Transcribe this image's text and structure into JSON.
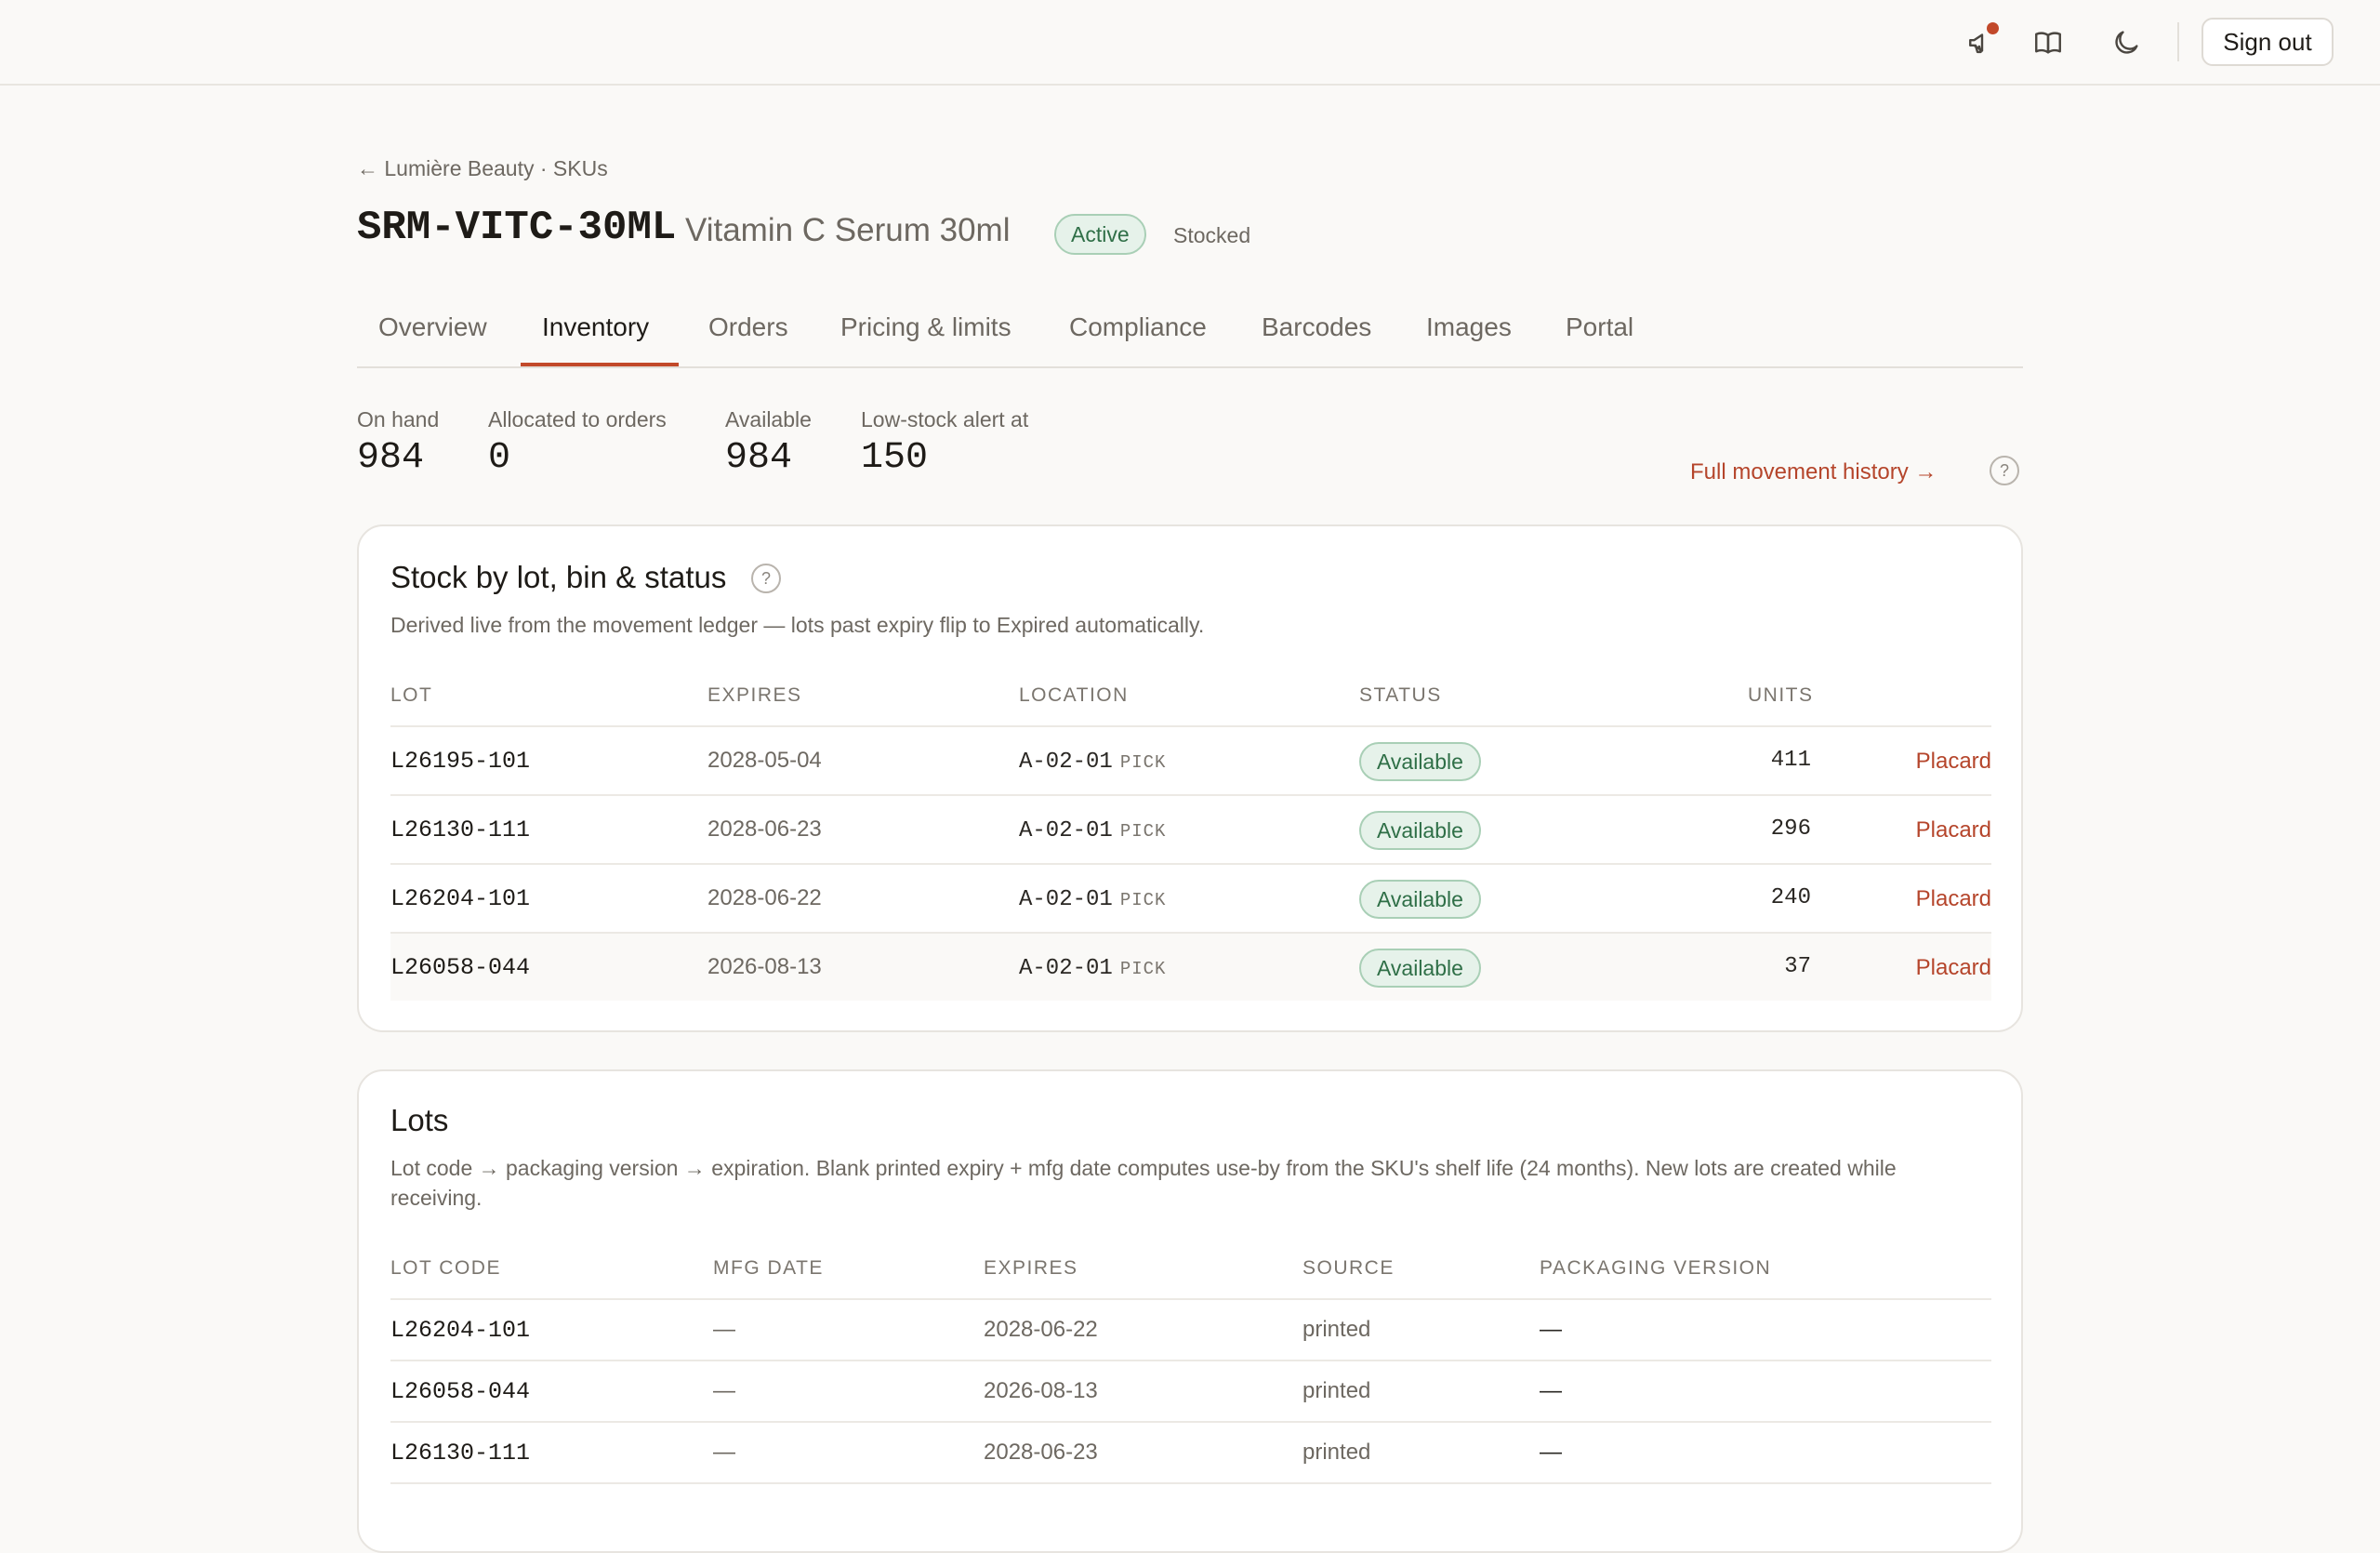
{
  "topbar": {
    "icons": [
      "megaphone-icon",
      "book-icon",
      "moon-icon"
    ],
    "sign_out": "Sign out",
    "accent": "#c2492a"
  },
  "header": {
    "breadcrumb": "← Lumière Beauty · SKUs",
    "sku_code": "SRM-VITC-30ML",
    "sku_name": "Vitamin C Serum 30ml",
    "status_badge": "Active",
    "stock_state": "Stocked"
  },
  "tabs": [
    {
      "label": "Overview",
      "active": false
    },
    {
      "label": "Inventory",
      "active": true
    },
    {
      "label": "Orders",
      "active": false
    },
    {
      "label": "Pricing & limits",
      "active": false
    },
    {
      "label": "Compliance",
      "active": false
    },
    {
      "label": "Barcodes",
      "active": false
    },
    {
      "label": "Images",
      "active": false
    },
    {
      "label": "Portal",
      "active": false
    }
  ],
  "stats": [
    {
      "label": "On hand",
      "value": "984"
    },
    {
      "label": "Allocated to orders",
      "value": "0"
    },
    {
      "label": "Available",
      "value": "984"
    },
    {
      "label": "Low-stock alert at",
      "value": "150"
    }
  ],
  "history_link": "Full movement history →",
  "help_glyph": "?",
  "stock_card": {
    "title": "Stock by lot, bin & status",
    "description": "Derived live from the movement ledger — lots past expiry flip to Expired automatically.",
    "columns": [
      "LOT",
      "EXPIRES",
      "LOCATION",
      "STATUS",
      "UNITS"
    ],
    "rows": [
      {
        "lot": "L26195-101",
        "expires": "2028-05-04",
        "location": "A-02-01",
        "bin_type": "PICK",
        "status": "Available",
        "units": "411",
        "action": "Placard"
      },
      {
        "lot": "L26130-111",
        "expires": "2028-06-23",
        "location": "A-02-01",
        "bin_type": "PICK",
        "status": "Available",
        "units": "296",
        "action": "Placard"
      },
      {
        "lot": "L26204-101",
        "expires": "2028-06-22",
        "location": "A-02-01",
        "bin_type": "PICK",
        "status": "Available",
        "units": "240",
        "action": "Placard"
      },
      {
        "lot": "L26058-044",
        "expires": "2026-08-13",
        "location": "A-02-01",
        "bin_type": "PICK",
        "status": "Available",
        "units": "37",
        "action": "Placard"
      }
    ]
  },
  "lots_card": {
    "title": "Lots",
    "description": "Lot code → packaging version → expiration. Blank printed expiry + mfg date computes use-by from the SKU's shelf life (24 months). New lots are created while receiving.",
    "columns": [
      "LOT CODE",
      "MFG DATE",
      "EXPIRES",
      "SOURCE",
      "PACKAGING VERSION"
    ],
    "rows": [
      {
        "lot_code": "L26204-101",
        "mfg_date": "—",
        "expires": "2028-06-22",
        "source": "printed",
        "packaging_version": "—"
      },
      {
        "lot_code": "L26058-044",
        "mfg_date": "—",
        "expires": "2026-08-13",
        "source": "printed",
        "packaging_version": "—"
      },
      {
        "lot_code": "L26130-111",
        "mfg_date": "—",
        "expires": "2028-06-23",
        "source": "printed",
        "packaging_version": "—"
      }
    ]
  }
}
